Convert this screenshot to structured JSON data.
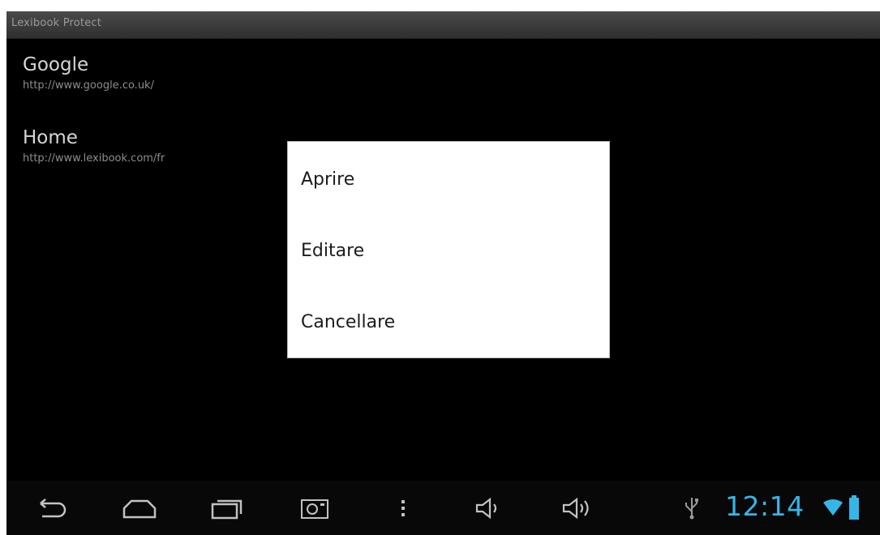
{
  "app": {
    "title": "Lexibook Protect"
  },
  "bookmarks": [
    {
      "title": "Google",
      "url": "http://www.google.co.uk/"
    },
    {
      "title": "Home",
      "url": "http://www.lexibook.com/fr"
    }
  ],
  "context_menu": {
    "items": [
      {
        "label": "Aprire"
      },
      {
        "label": "Editare"
      },
      {
        "label": "Cancellare"
      }
    ]
  },
  "system_bar": {
    "buttons": [
      {
        "icon": "back-icon"
      },
      {
        "icon": "home-icon"
      },
      {
        "icon": "recent-apps-icon"
      },
      {
        "icon": "screenshot-icon"
      },
      {
        "icon": "menu-icon"
      },
      {
        "icon": "volume-down-icon"
      },
      {
        "icon": "volume-up-icon"
      }
    ],
    "status": {
      "usb_icon": "usb-icon",
      "time": "12:14",
      "wifi_icon": "wifi-icon",
      "battery_icon": "battery-icon"
    }
  },
  "colors": {
    "background": "#000000",
    "dialog": "#ffffff",
    "clock": "#35b6e8",
    "icons": "#bfbfbf"
  }
}
